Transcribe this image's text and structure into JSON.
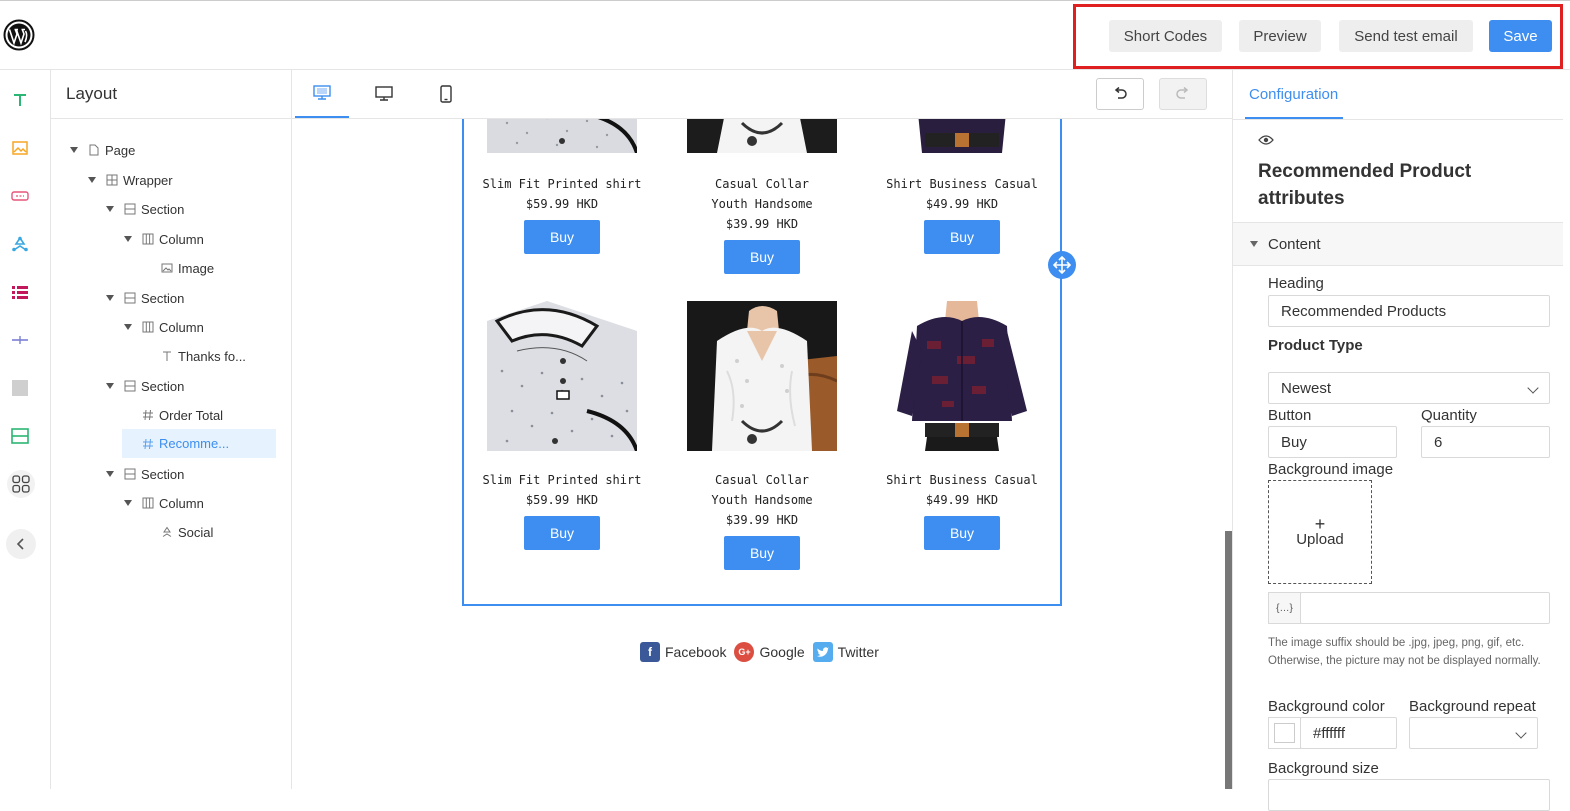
{
  "toolbar": {
    "short_codes": "Short Codes",
    "preview": "Preview",
    "send_test_email": "Send test email",
    "save": "Save"
  },
  "layout": {
    "title": "Layout",
    "tree": [
      {
        "label": "Page",
        "icon": "page-icon"
      },
      {
        "label": "Wrapper",
        "icon": "wrapper-icon"
      },
      {
        "label": "Section",
        "icon": "section-icon"
      },
      {
        "label": "Column",
        "icon": "column-icon"
      },
      {
        "label": "Image",
        "icon": "image-icon"
      },
      {
        "label": "Section",
        "icon": "section-icon"
      },
      {
        "label": "Column",
        "icon": "column-icon"
      },
      {
        "label": "Thanks fo...",
        "icon": "text-icon"
      },
      {
        "label": "Section",
        "icon": "section-icon"
      },
      {
        "label": "Order Total",
        "icon": "hash-icon"
      },
      {
        "label": "Recomme...",
        "icon": "hash-icon"
      },
      {
        "label": "Section",
        "icon": "section-icon"
      },
      {
        "label": "Column",
        "icon": "column-icon"
      },
      {
        "label": "Social",
        "icon": "social-icon"
      }
    ]
  },
  "products": {
    "row1": [
      {
        "name": "Slim Fit Printed shirt",
        "price": "$59.99 HKD",
        "button": "Buy"
      },
      {
        "name": "Casual Collar Youth Handsome",
        "price": "$39.99 HKD",
        "button": "Buy"
      },
      {
        "name": "Shirt Business Casual",
        "price": "$49.99 HKD",
        "button": "Buy"
      }
    ],
    "row2": [
      {
        "name": "Slim Fit Printed shirt",
        "price": "$59.99 HKD",
        "button": "Buy"
      },
      {
        "name": "Casual Collar Youth Handsome",
        "price": "$39.99 HKD",
        "button": "Buy"
      },
      {
        "name": "Shirt Business Casual",
        "price": "$49.99 HKD",
        "button": "Buy"
      }
    ]
  },
  "social": {
    "facebook": "Facebook",
    "google": "Google",
    "twitter": "Twitter"
  },
  "config": {
    "tab": "Configuration",
    "title": "Recommended Product attributes",
    "section": "Content",
    "heading_label": "Heading",
    "heading_value": "Recommended Products",
    "product_type_label": "Product Type",
    "product_type_value": "Newest",
    "button_label": "Button",
    "button_value": "Buy",
    "quantity_label": "Quantity",
    "quantity_value": "6",
    "bg_image_label": "Background image",
    "upload_label": "Upload",
    "var_prefix": "{…}",
    "hint": "The image suffix should be .jpg, jpeg, png, gif, etc. Otherwise, the picture may not be displayed normally.",
    "bg_color_label": "Background color",
    "bg_color_value": "#ffffff",
    "bg_repeat_label": "Background repeat",
    "bg_size_label": "Background size"
  },
  "colors": {
    "accent": "#3d8ef0",
    "highlight": "#e02020"
  }
}
